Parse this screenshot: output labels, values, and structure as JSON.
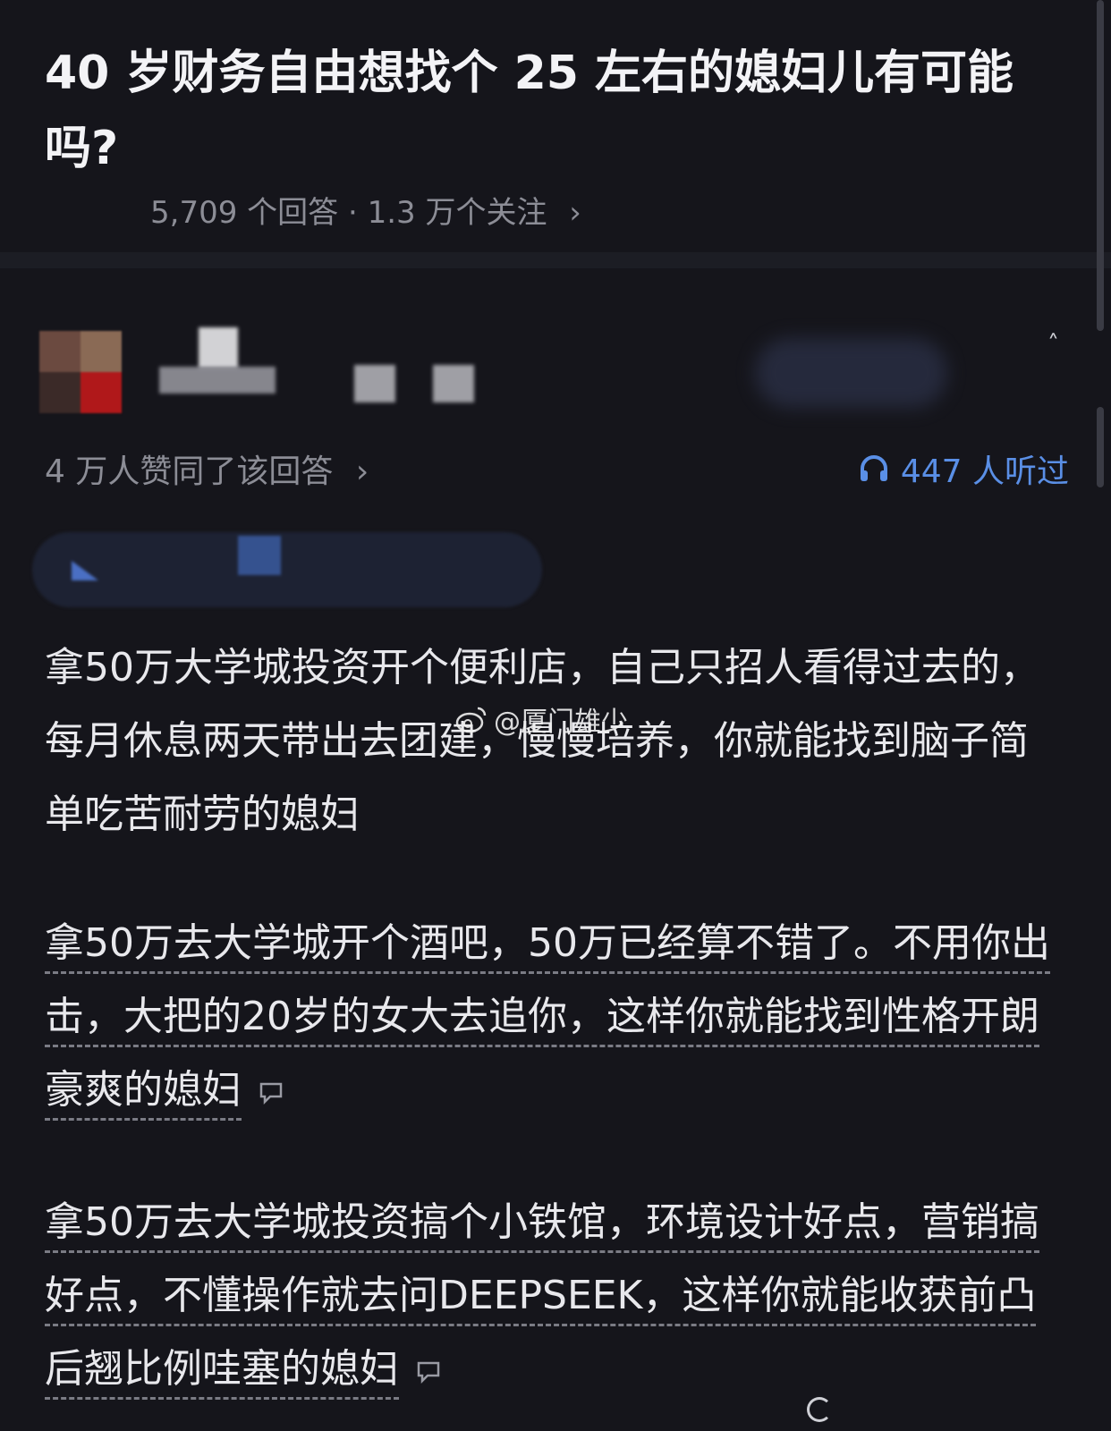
{
  "question": {
    "title": "40 岁财务自由想找个 25 左右的媳妇儿有可能吗?",
    "answers_count": "5,709 个回答",
    "dot": "·",
    "followers": "1.3 万个关注",
    "chevron": "›"
  },
  "answer_header": {
    "likes_text": "4 万人赞同了该回答",
    "chevron": "›",
    "listen_text": "447 人听过",
    "listen_icon": "headphones-icon"
  },
  "colors": {
    "background": "#15151b",
    "accent": "#5a8fe6",
    "muted_text": "#8c8d96"
  },
  "watermark": "@厦门雄少",
  "paragraphs": [
    "拿50万大学城投资开个便利店，自己只招人看得过去的，每月休息两天带出去团建，慢慢培养，你就能找到脑子简单吃苦耐劳的媳妇",
    "拿50万去大学城开个酒吧，50万已经算不错了。不用你出击，大把的20岁的女大去追你，这样你就能找到性格开朗豪爽的媳妇",
    "拿50万去大学城投资搞个小铁馆，环境设计好点，营销搞好点，不懂操作就去问DEEPSEEK，这样你就能收获前凸后翘比例哇塞的媳妇"
  ]
}
